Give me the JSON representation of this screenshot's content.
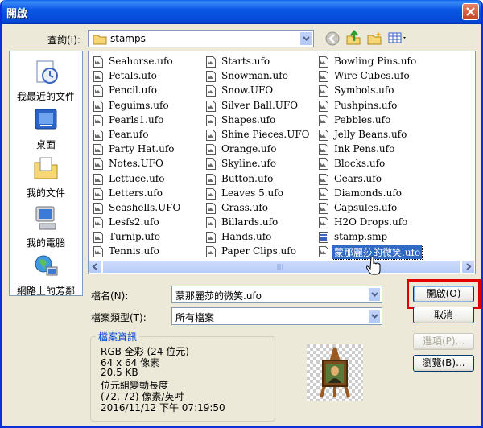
{
  "title": "開啟",
  "lookin": {
    "label": "查詢(I):",
    "value": "stamps"
  },
  "sidebar": {
    "items": [
      {
        "label": "我最近的文件",
        "icon": "recent-documents-icon"
      },
      {
        "label": "桌面",
        "icon": "desktop-icon"
      },
      {
        "label": "我的文件",
        "icon": "my-documents-icon"
      },
      {
        "label": "我的電腦",
        "icon": "my-computer-icon"
      },
      {
        "label": "網路上的芳鄰",
        "icon": "network-places-icon"
      }
    ]
  },
  "files": {
    "col1": [
      "Seahorse.ufo",
      "Petals.ufo",
      "Pencil.ufo",
      "Peguims.ufo",
      "Pearls1.ufo",
      "Pear.ufo",
      "Party Hat.ufo",
      "Notes.UFO",
      "Lettuce.ufo",
      "Letters.ufo",
      "Seashells.UFO",
      "Lesfs2.ufo",
      "Turnip.ufo",
      "Tennis.ufo"
    ],
    "col2": [
      "Starts.ufo",
      "Snowman.ufo",
      "Snow.UFO",
      "Silver Ball.UFO",
      "Shapes.ufo",
      "Shine Pieces.UFO",
      "Orange.ufo",
      "Skyline.ufo",
      "Button.ufo",
      "Leaves 5.ufo",
      "Grass.ufo",
      "Billards.ufo",
      "Hands.ufo",
      "Paper Clips.ufo"
    ],
    "col3": [
      "Bowling Pins.ufo",
      "Wire Cubes.ufo",
      "Symbols.ufo",
      "Pushpins.ufo",
      "Pebbles.ufo",
      "Jelly Beans.ufo",
      "Ink Pens.ufo",
      "Blocks.ufo",
      "Gears.ufo",
      "Diamonds.ufo",
      "Capsules.ufo",
      "H2O Drops.ufo",
      "stamp.smp",
      "蒙那麗莎的微笑.ufo"
    ],
    "selected": "蒙那麗莎的微笑.ufo"
  },
  "filename": {
    "label": "檔名(N):",
    "value": "蒙那麗莎的微笑.ufo"
  },
  "filetype": {
    "label": "檔案類型(T):",
    "value": "所有檔案"
  },
  "buttons": {
    "open": "開啟(O)",
    "cancel": "取消",
    "options": "選項(P)...",
    "browse": "瀏覽(B)..."
  },
  "info": {
    "title": "檔案資訊",
    "lines": [
      "RGB 全彩 (24 位元)",
      "64 x 64 像素",
      "20.5 KB",
      "位元組變動長度",
      "(72, 72) 像素/英吋",
      "2016/11/12  下午 07:19:50"
    ]
  },
  "colors": {
    "selection": "#316ac5",
    "title_bar": "#0a57e4",
    "highlight_box": "#e00000"
  }
}
